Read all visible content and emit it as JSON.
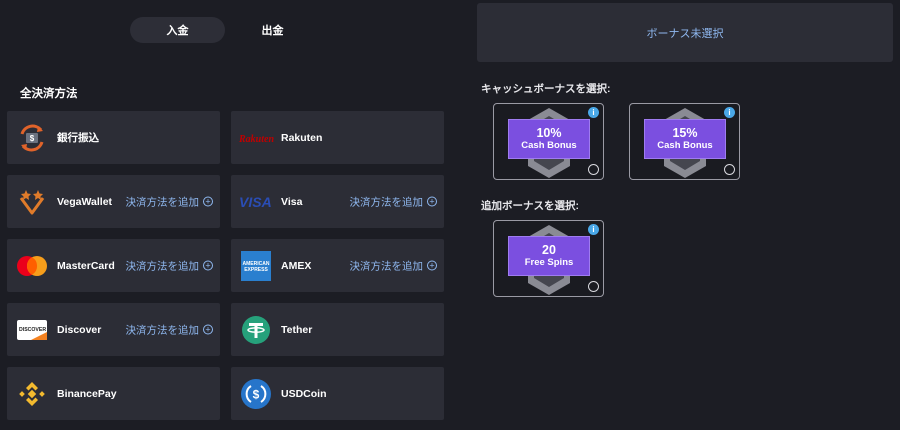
{
  "tabs": [
    {
      "label": "入金",
      "active": true
    },
    {
      "label": "出金",
      "active": false
    }
  ],
  "section_title": "全決済方法",
  "add_label": "決済方法を追加",
  "methods": [
    {
      "name": "銀行振込",
      "icon": "bank-transfer-icon"
    },
    {
      "name": "Rakuten",
      "icon": "rakuten-logo"
    },
    {
      "name": "VegaWallet",
      "icon": "vegawallet-icon",
      "add": true
    },
    {
      "name": "Visa",
      "icon": "visa-logo",
      "add": true
    },
    {
      "name": "MasterCard",
      "icon": "mastercard-logo",
      "add": true
    },
    {
      "name": "AMEX",
      "icon": "amex-logo",
      "add": true
    },
    {
      "name": "Discover",
      "icon": "discover-logo",
      "add": true
    },
    {
      "name": "Tether",
      "icon": "tether-icon"
    },
    {
      "name": "BinancePay",
      "icon": "binance-icon"
    },
    {
      "name": "USDCoin",
      "icon": "usdcoin-icon"
    }
  ],
  "logo_text": {
    "rakuten": "Rakuten",
    "visa": "VISA",
    "amex": "AMERICAN EXPRESS",
    "discover": "DISCOVER"
  },
  "no_bonus": "ボーナス未選択",
  "cash_bonus_title": "キャッシュボーナスを選択:",
  "extra_bonus_title": "追加ボーナスを選択:",
  "bonuses": [
    {
      "big": "10%",
      "small": "Cash Bonus"
    },
    {
      "big": "15%",
      "small": "Cash Bonus"
    },
    {
      "big": "20",
      "small": "Free Spins"
    }
  ],
  "colors": {
    "accent_link": "#8fb8f0",
    "bonus_purple": "#7b4fe0",
    "card_bg": "#2c2d36",
    "page_bg": "#1c1d24"
  }
}
